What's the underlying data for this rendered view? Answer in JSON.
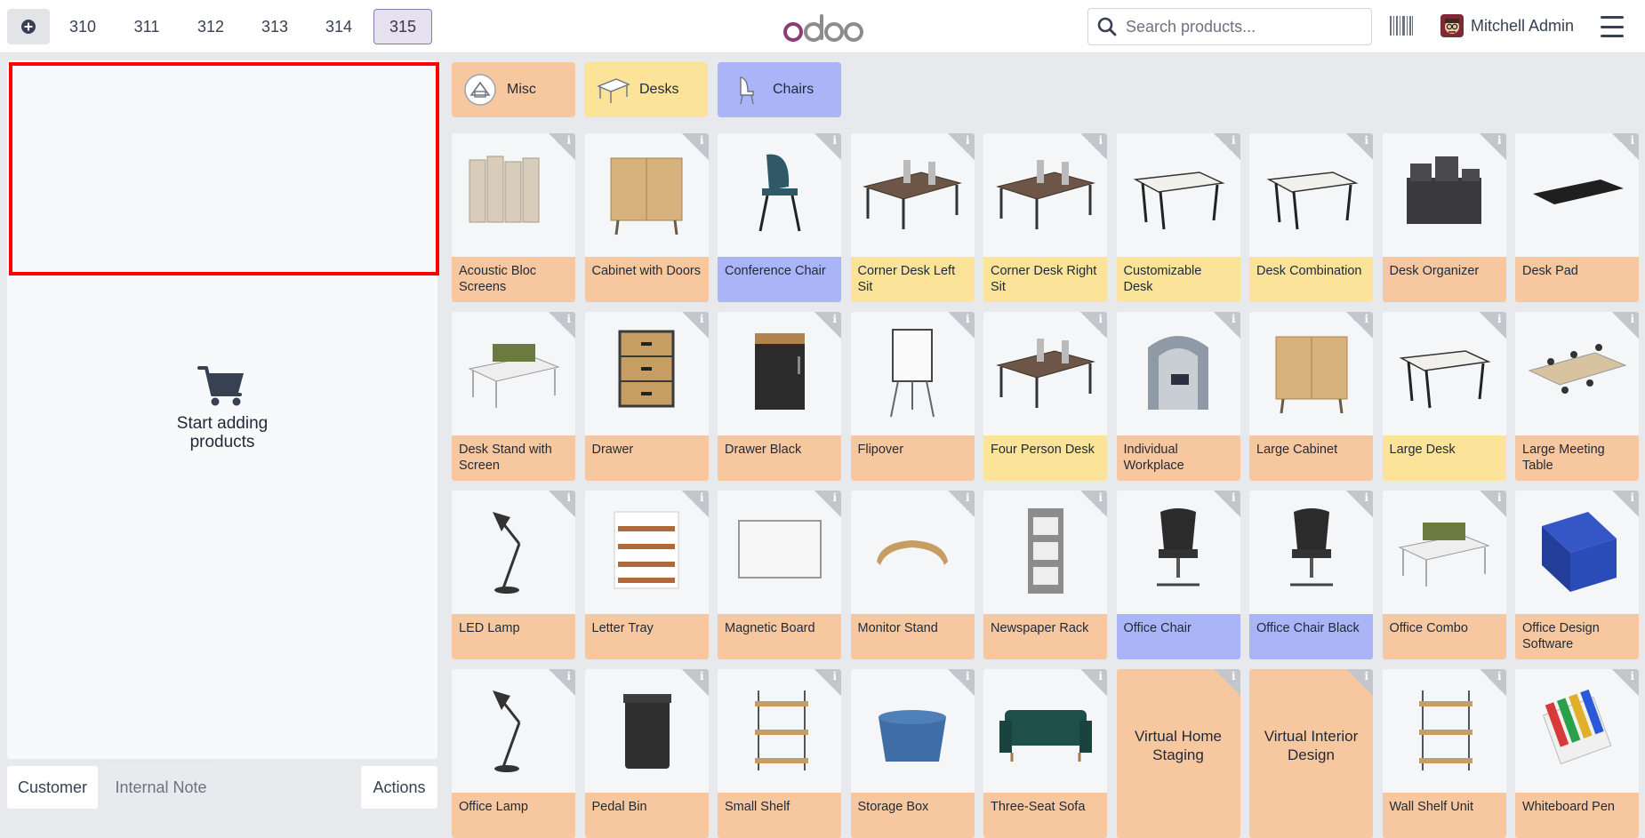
{
  "topbar": {
    "order_tabs": [
      "310",
      "311",
      "312",
      "313",
      "314",
      "315"
    ],
    "active_order": "315",
    "logo_text": "odoo",
    "search_placeholder": "Search products...",
    "user_name": "Mitchell Admin"
  },
  "order_panel": {
    "empty_text_line1": "Start adding",
    "empty_text_line2": "products"
  },
  "bottom_buttons": {
    "customer": "Customer",
    "internal_note": "Internal Note",
    "actions": "Actions"
  },
  "categories": [
    {
      "label": "Misc",
      "color": "#f7c8a0"
    },
    {
      "label": "Desks",
      "color": "#fbe39a"
    },
    {
      "label": "Chairs",
      "color": "#a9b5f7"
    }
  ],
  "products": [
    {
      "name": "Acoustic Bloc Screens",
      "category": "misc",
      "icon": "screen-panel-icon"
    },
    {
      "name": "Cabinet with Doors",
      "category": "misc",
      "icon": "cabinet-icon"
    },
    {
      "name": "Conference Chair",
      "category": "chairs",
      "icon": "chair-icon"
    },
    {
      "name": "Corner Desk Left Sit",
      "category": "desks",
      "icon": "desk-icon"
    },
    {
      "name": "Corner Desk Right Sit",
      "category": "desks",
      "icon": "desk-icon"
    },
    {
      "name": "Customizable Desk",
      "category": "desks",
      "icon": "table-icon"
    },
    {
      "name": "Desk Combination",
      "category": "desks",
      "icon": "table-icon"
    },
    {
      "name": "Desk Organizer",
      "category": "misc",
      "icon": "organizer-icon"
    },
    {
      "name": "Desk Pad",
      "category": "misc",
      "icon": "pad-icon"
    },
    {
      "name": "Desk Stand with Screen",
      "category": "misc",
      "icon": "desk-screen-icon"
    },
    {
      "name": "Drawer",
      "category": "misc",
      "icon": "drawer-icon"
    },
    {
      "name": "Drawer Black",
      "category": "misc",
      "icon": "drawer-black-icon"
    },
    {
      "name": "Flipover",
      "category": "misc",
      "icon": "flipchart-icon"
    },
    {
      "name": "Four Person Desk",
      "category": "desks",
      "icon": "desk-icon"
    },
    {
      "name": "Individual Workplace",
      "category": "misc",
      "icon": "booth-icon"
    },
    {
      "name": "Large Cabinet",
      "category": "misc",
      "icon": "cabinet-icon"
    },
    {
      "name": "Large Desk",
      "category": "desks",
      "icon": "table-icon"
    },
    {
      "name": "Large Meeting Table",
      "category": "misc",
      "icon": "meeting-table-icon"
    },
    {
      "name": "LED Lamp",
      "category": "misc",
      "icon": "lamp-icon"
    },
    {
      "name": "Letter Tray",
      "category": "misc",
      "icon": "tray-icon"
    },
    {
      "name": "Magnetic Board",
      "category": "misc",
      "icon": "whiteboard-icon"
    },
    {
      "name": "Monitor Stand",
      "category": "misc",
      "icon": "monitor-stand-icon"
    },
    {
      "name": "Newspaper Rack",
      "category": "misc",
      "icon": "rack-icon"
    },
    {
      "name": "Office Chair",
      "category": "chairs",
      "icon": "office-chair-icon"
    },
    {
      "name": "Office Chair Black",
      "category": "chairs",
      "icon": "office-chair-icon"
    },
    {
      "name": "Office Combo",
      "category": "misc",
      "icon": "desk-screen-icon"
    },
    {
      "name": "Office Design Software",
      "category": "misc",
      "icon": "software-box-icon"
    },
    {
      "name": "Office Lamp",
      "category": "misc",
      "icon": "lamp-icon"
    },
    {
      "name": "Pedal Bin",
      "category": "misc",
      "icon": "bin-icon"
    },
    {
      "name": "Small Shelf",
      "category": "misc",
      "icon": "shelf-icon"
    },
    {
      "name": "Storage Box",
      "category": "misc",
      "icon": "box-icon"
    },
    {
      "name": "Three-Seat Sofa",
      "category": "misc",
      "icon": "sofa-icon"
    },
    {
      "name": "Virtual Home Staging",
      "category": "misc",
      "icon": ""
    },
    {
      "name": "Virtual Interior Design",
      "category": "misc",
      "icon": ""
    },
    {
      "name": "Wall Shelf Unit",
      "category": "misc",
      "icon": "shelf-icon"
    },
    {
      "name": "Whiteboard Pen",
      "category": "misc",
      "icon": "pens-icon"
    }
  ],
  "colors": {
    "misc": "#f7c8a0",
    "desks": "#fbe39a",
    "chairs": "#a9b5f7",
    "selection": "#ff0000"
  }
}
